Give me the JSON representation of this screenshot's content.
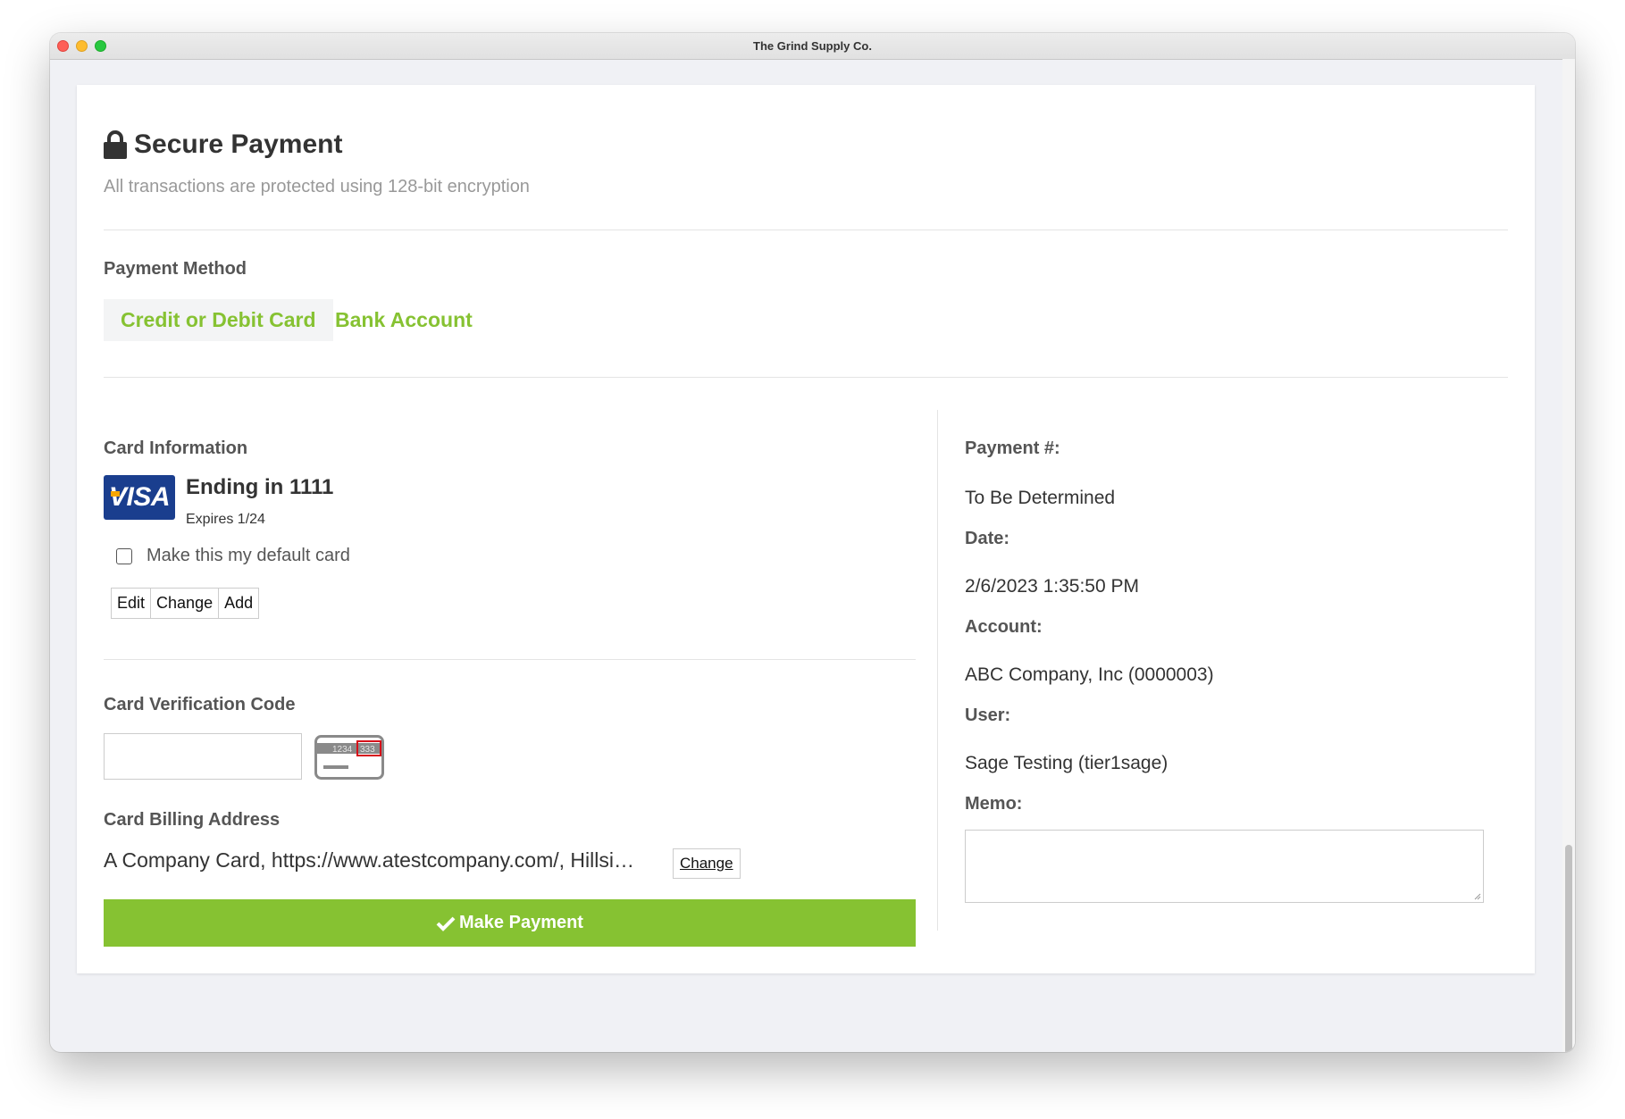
{
  "window": {
    "title": "The Grind Supply Co."
  },
  "header": {
    "title": "Secure Payment",
    "subtitle": "All transactions are protected using 128-bit encryption"
  },
  "payment_method": {
    "label": "Payment Method",
    "tabs": [
      {
        "label": "Credit or Debit Card",
        "active": true
      },
      {
        "label": "Bank Account",
        "active": false
      }
    ]
  },
  "card_info": {
    "label": "Card Information",
    "brand": "VISA",
    "ending": "Ending in 1111",
    "expires": "Expires 1/24",
    "default_label": "Make this my default card",
    "buttons": {
      "edit": "Edit",
      "change": "Change",
      "add": "Add"
    }
  },
  "cvc": {
    "label": "Card Verification Code",
    "card_number_hint": "1234",
    "cvc_hint": "333"
  },
  "billing": {
    "label": "Card Billing Address",
    "address": "A Company Card, https://www.atestcompany.com/, Hillsi…",
    "change_label": "Change"
  },
  "submit": {
    "label": "Make Payment"
  },
  "details": {
    "payment_label": "Payment #:",
    "payment_value": "To Be Determined",
    "date_label": "Date:",
    "date_value": "2/6/2023 1:35:50 PM",
    "account_label": "Account:",
    "account_value": "ABC Company, Inc (0000003)",
    "user_label": "User:",
    "user_value": "Sage Testing (tier1sage)",
    "memo_label": "Memo:"
  },
  "colors": {
    "accent": "#86c232",
    "visa": "#1a3e8e"
  }
}
